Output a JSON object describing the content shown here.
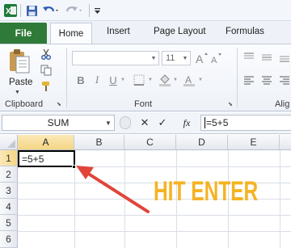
{
  "quick_access": {
    "icons": [
      "excel-logo-icon",
      "save-icon",
      "undo-icon",
      "redo-icon",
      "customize-qat-icon"
    ]
  },
  "ribbon_tabs": {
    "file": "File",
    "home": "Home",
    "insert": "Insert",
    "page_layout": "Page Layout",
    "formulas": "Formulas"
  },
  "clipboard": {
    "paste_label": "Paste",
    "group_label": "Clipboard"
  },
  "font": {
    "font_size": "11",
    "group_label": "Font",
    "bold": "B",
    "italic": "I",
    "underline": "U"
  },
  "alignment": {
    "group_label_partial": "Alig"
  },
  "formula_bar": {
    "name_box": "SUM",
    "cancel_symbol": "✕",
    "enter_symbol": "✓",
    "fx_symbol": "fx",
    "formula": "=5+5"
  },
  "grid": {
    "columns": [
      "A",
      "B",
      "C",
      "D",
      "E"
    ],
    "rows": [
      "1",
      "2",
      "3",
      "4",
      "5",
      "6"
    ],
    "active_cell": {
      "ref": "A1",
      "value": "=5+5"
    }
  },
  "annotation": {
    "text": "HIT ENTER",
    "color": "#f5b323",
    "arrow_color": "#e0453a"
  }
}
